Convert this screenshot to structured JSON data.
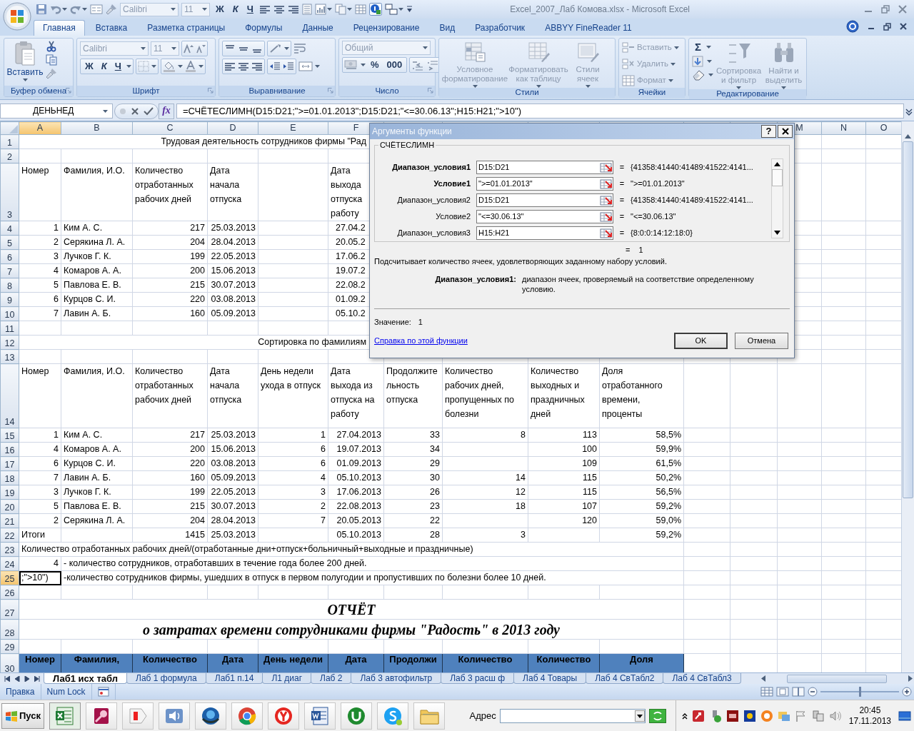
{
  "window": {
    "title": "Excel_2007_Лаб Комова.xlsx - Microsoft Excel"
  },
  "quick_access": {
    "font": "Calibri",
    "size": "11",
    "bold": "Ж",
    "italic": "К",
    "underline": "Ч"
  },
  "ribbon_tabs": [
    {
      "label": "Главная",
      "selected": true
    },
    {
      "label": "Вставка",
      "selected": false
    },
    {
      "label": "Разметка страницы",
      "selected": false
    },
    {
      "label": "Формулы",
      "selected": false
    },
    {
      "label": "Данные",
      "selected": false
    },
    {
      "label": "Рецензирование",
      "selected": false
    },
    {
      "label": "Вид",
      "selected": false
    },
    {
      "label": "Разработчик",
      "selected": false
    },
    {
      "label": "ABBYY FineReader 11",
      "selected": false
    }
  ],
  "ribbon_groups": [
    {
      "title": "Буфер обмена",
      "items": [
        {
          "kind": "large",
          "label": "Вставить",
          "disabled": false
        }
      ]
    },
    {
      "title": "Шрифт",
      "items": [
        {
          "kind": "combo",
          "label": "Calibri",
          "disabled": true
        },
        {
          "kind": "combo",
          "label": "11",
          "disabled": true
        },
        {
          "kind": "glyph",
          "label": "Ж",
          "disabled": false
        },
        {
          "kind": "glyph",
          "label": "К",
          "disabled": false
        },
        {
          "kind": "glyph",
          "label": "Ч",
          "disabled": false
        }
      ]
    },
    {
      "title": "Выравнивание"
    },
    {
      "title": "Число",
      "items": [
        {
          "kind": "combo",
          "label": "Общий",
          "disabled": true
        },
        {
          "kind": "glyph",
          "label": "%",
          "disabled": false
        },
        {
          "kind": "glyph",
          "label": "000",
          "disabled": false
        }
      ]
    },
    {
      "title": "Стили",
      "items": [
        {
          "kind": "large",
          "label": "Условное форматирование",
          "disabled": true
        },
        {
          "kind": "large",
          "label": "Форматировать как таблицу",
          "disabled": true
        },
        {
          "kind": "large",
          "label": "Стили ячеек",
          "disabled": true
        }
      ]
    },
    {
      "title": "Ячейки",
      "items": [
        {
          "kind": "small",
          "label": "Вставить",
          "disabled": true
        },
        {
          "kind": "small",
          "label": "Удалить",
          "disabled": true
        },
        {
          "kind": "small",
          "label": "Формат",
          "disabled": true
        }
      ]
    },
    {
      "title": "Редактирование",
      "items": [
        {
          "kind": "glyph",
          "label": "Σ",
          "disabled": false
        },
        {
          "kind": "large",
          "label": "Сортировка и фильтр",
          "disabled": true
        },
        {
          "kind": "large",
          "label": "Найти и выделить",
          "disabled": true
        }
      ]
    }
  ],
  "formula_bar": {
    "name_box": "ДЕНЬНЕД",
    "function_button": "fx",
    "formula": "=СЧЁТЕСЛИМН(D15:D21;\">=01.01.2013\";D15:D21;\"<=30.06.13\";H15:H21;\">10\")"
  },
  "sheet": {
    "column_headers": [
      {
        "label": "A",
        "selected": true
      },
      {
        "label": "B",
        "selected": false
      },
      {
        "label": "C",
        "selected": false
      },
      {
        "label": "D",
        "selected": false
      },
      {
        "label": "E",
        "selected": false
      },
      {
        "label": "F",
        "selected": false
      },
      {
        "label": "M",
        "selected": false
      },
      {
        "label": "N",
        "selected": false
      },
      {
        "label": "O",
        "selected": false
      }
    ],
    "rows": [
      {
        "number": "1",
        "kind": "caption",
        "selected": false,
        "text": "Трудовая деятельность сотрудников фирмы \"Рад"
      },
      {
        "number": "2",
        "kind": "blank",
        "selected": false
      },
      {
        "number": "3",
        "kind": "header",
        "selected": false,
        "cells": [
          "Номер",
          "Фамилия, И.О.",
          "Количество отработанных рабочих дней",
          "Дата начала отпуска",
          null,
          "Дата выхода отпуска работу"
        ]
      },
      {
        "number": "4",
        "kind": "data",
        "selected": false,
        "cells": [
          "1",
          "Ким А. С.",
          "217",
          "25.03.2013",
          null,
          "27.04.2"
        ]
      },
      {
        "number": "5",
        "kind": "data",
        "selected": false,
        "cells": [
          "2",
          "Серякина Л. А.",
          "204",
          "28.04.2013",
          null,
          "20.05.2"
        ]
      },
      {
        "number": "6",
        "kind": "data",
        "selected": false,
        "cells": [
          "3",
          "Лучков Г. К.",
          "199",
          "22.05.2013",
          null,
          "17.06.2"
        ]
      },
      {
        "number": "7",
        "kind": "data",
        "selected": false,
        "cells": [
          "4",
          "Комаров А. А.",
          "200",
          "15.06.2013",
          null,
          "19.07.2"
        ]
      },
      {
        "number": "8",
        "kind": "data",
        "selected": false,
        "cells": [
          "5",
          "Павлова Е. В.",
          "215",
          "30.07.2013",
          null,
          "22.08.2"
        ]
      },
      {
        "number": "9",
        "kind": "data",
        "selected": false,
        "cells": [
          "6",
          "Курцов С. И.",
          "220",
          "03.08.2013",
          null,
          "01.09.2"
        ]
      },
      {
        "number": "10",
        "kind": "data",
        "selected": false,
        "cells": [
          "7",
          "Лавин А. Б.",
          "160",
          "05.09.2013",
          null,
          "05.10.2"
        ]
      },
      {
        "number": "11",
        "kind": "blank",
        "selected": false
      },
      {
        "number": "12",
        "kind": "caption",
        "selected": false,
        "text": "Сортировка по фамилиям"
      },
      {
        "number": "13",
        "kind": "blank",
        "selected": false
      },
      {
        "number": "14",
        "kind": "header",
        "selected": false,
        "cells": [
          "Номер",
          "Фамилия, И.О.",
          "Количество отработанных рабочих дней",
          "Дата начала отпуска",
          "День недели ухода в отпуск",
          "Дата выхода из отпуска на работу",
          "Продолжительность отпуска",
          "Количество рабочих дней, пропущенных по болезни",
          "Количество выходных и праздничных дней",
          "Доля отработанного времени, проценты"
        ]
      },
      {
        "number": "15",
        "kind": "data",
        "selected": false,
        "cells": [
          "1",
          "Ким А. С.",
          "217",
          "25.03.2013",
          "1",
          "27.04.2013",
          "33",
          "8",
          "113",
          "58,5%"
        ]
      },
      {
        "number": "16",
        "kind": "data",
        "selected": false,
        "cells": [
          "4",
          "Комаров А. А.",
          "200",
          "15.06.2013",
          "6",
          "19.07.2013",
          "34",
          null,
          "100",
          "59,9%"
        ]
      },
      {
        "number": "17",
        "kind": "data",
        "selected": false,
        "cells": [
          "6",
          "Курцов С. И.",
          "220",
          "03.08.2013",
          "6",
          "01.09.2013",
          "29",
          null,
          "109",
          "61,5%"
        ]
      },
      {
        "number": "18",
        "kind": "data",
        "selected": false,
        "cells": [
          "7",
          "Лавин А. Б.",
          "160",
          "05.09.2013",
          "4",
          "05.10.2013",
          "30",
          "14",
          "115",
          "50,2%"
        ]
      },
      {
        "number": "19",
        "kind": "data",
        "selected": false,
        "cells": [
          "3",
          "Лучков Г. К.",
          "199",
          "22.05.2013",
          "3",
          "17.06.2013",
          "26",
          "12",
          "115",
          "56,5%"
        ]
      },
      {
        "number": "20",
        "kind": "data",
        "selected": false,
        "cells": [
          "5",
          "Павлова Е. В.",
          "215",
          "30.07.2013",
          "2",
          "22.08.2013",
          "23",
          "18",
          "107",
          "59,2%"
        ]
      },
      {
        "number": "21",
        "kind": "data",
        "selected": false,
        "cells": [
          "2",
          "Серякина Л. А.",
          "204",
          "28.04.2013",
          "7",
          "20.05.2013",
          "22",
          null,
          "120",
          "59,0%"
        ]
      },
      {
        "number": "22",
        "kind": "totals",
        "selected": false,
        "cells": [
          "Итоги",
          null,
          "1415",
          "25.03.2013",
          null,
          "05.10.2013",
          "28",
          "3",
          null,
          "59,2%"
        ]
      },
      {
        "number": "23",
        "kind": "note",
        "selected": false,
        "cells": [
          "Количество отработанных рабочих дней/(отработанные дни+отпуск+больничный+выходные и праздничные)"
        ]
      },
      {
        "number": "24",
        "kind": "note",
        "selected": false,
        "cells": [
          "4",
          "- количество сотрудников, отработавших в течение года более 200 дней."
        ]
      },
      {
        "number": "25",
        "kind": "note",
        "selected": true,
        "cells": [
          ";\">10\")",
          "-количество сотрудников фирмы, ушедших в отпуск в первом полугодии и пропустивших по болезни более 10 дней."
        ]
      },
      {
        "number": "26",
        "kind": "blank",
        "selected": false
      },
      {
        "number": "27",
        "kind": "report_title",
        "selected": false,
        "text": "ОТЧЁТ"
      },
      {
        "number": "28",
        "kind": "report_title",
        "selected": false,
        "text": "о затратах времени сотрудниками фирмы \"Радость\" в 2013 году"
      },
      {
        "number": "29",
        "kind": "blank",
        "selected": false
      },
      {
        "number": "30",
        "kind": "table_head",
        "selected": false,
        "cells": [
          "Номер",
          "Фамилия,",
          "Количество",
          "Дата",
          "День недели",
          "Дата",
          "Продолжи",
          "Количество",
          "Количество",
          "Доля"
        ]
      }
    ]
  },
  "dialog": {
    "title": "Аргументы функции",
    "help": "?",
    "function_name": "СЧЁТЕСЛИМН",
    "arguments": [
      {
        "label": "Диапазон_условия1",
        "required": true,
        "value": "D15:D21",
        "sign": "=",
        "result": "{41358:41440:41489:41522:4141..."
      },
      {
        "label": "Условие1",
        "required": true,
        "value": "\">=01.01.2013\"",
        "sign": "=",
        "result": "\">=01.01.2013\""
      },
      {
        "label": "Диапазон_условия2",
        "required": false,
        "value": "D15:D21",
        "sign": "=",
        "result": "{41358:41440:41489:41522:4141..."
      },
      {
        "label": "Условие2",
        "required": false,
        "value": "\"<=30.06.13\"",
        "sign": "=",
        "result": "\"<=30.06.13\""
      },
      {
        "label": "Диапазон_условия3",
        "required": false,
        "value": "H15:H21",
        "sign": "=",
        "result": "{8:0:0:14:12:18:0}"
      }
    ],
    "total_sign": "=",
    "total": "1",
    "description": "Подсчитывает количество ячеек, удовлетворяющих заданному набору условий.",
    "arg_name": "Диапазон_условия1:",
    "arg_text": "диапазон ячеек, проверяемый на соответствие определенному условию.",
    "value_label": "Значение:",
    "value": "1",
    "help_link": "Справка по этой функции",
    "buttons": [
      {
        "label": "OK",
        "default": true
      },
      {
        "label": "Отмена",
        "default": false
      }
    ]
  },
  "sheet_tabs": [
    {
      "label": "Лаб1 исх табл",
      "selected": true
    },
    {
      "label": "Лаб 1 формула",
      "selected": false
    },
    {
      "label": "Лаб1 п.14",
      "selected": false
    },
    {
      "label": "Л1 диаг",
      "selected": false
    },
    {
      "label": "Лаб 2",
      "selected": false
    },
    {
      "label": "Лаб 3 автофильтр",
      "selected": false
    },
    {
      "label": "Лаб 3 расш ф",
      "selected": false
    },
    {
      "label": "Лаб 4 Товары",
      "selected": false
    },
    {
      "label": "Лаб 4 СвТабл2",
      "selected": false
    },
    {
      "label": "Лаб 4 СвТабл3",
      "selected": false
    }
  ],
  "status_bar": {
    "items": [
      "Правка",
      "Num Lock"
    ],
    "zoom": {
      "level": 0.5
    }
  },
  "taskbar": {
    "start": "Пуск",
    "address_label": "Адрес",
    "time": "20:45",
    "date": "17.11.2013"
  }
}
